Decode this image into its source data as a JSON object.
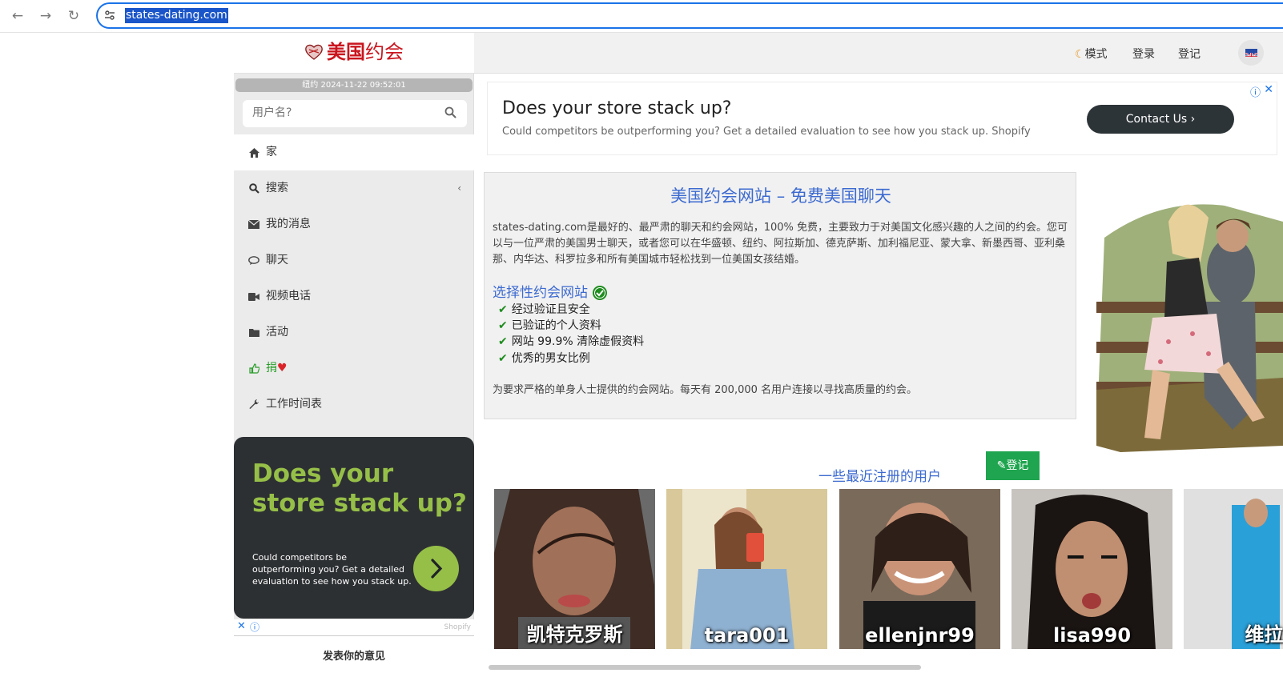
{
  "browser": {
    "url": "states-dating.com"
  },
  "brand": {
    "name_bold": "美国",
    "name_rest": "约会"
  },
  "clock": "纽约 2024-11-22 09:52:01",
  "search": {
    "placeholder": "用户名?"
  },
  "menu": [
    {
      "label": "家",
      "icon": "home-icon"
    },
    {
      "label": "搜索",
      "icon": "search-icon"
    },
    {
      "label": "我的消息",
      "icon": "envelope-icon"
    },
    {
      "label": "聊天",
      "icon": "chat-icon"
    },
    {
      "label": "视频电话",
      "icon": "video-camera-icon"
    },
    {
      "label": "活动",
      "icon": "folder-icon"
    },
    {
      "label": "捐",
      "icon": "thumbs-up-icon"
    },
    {
      "label": "工作时间表",
      "icon": "wrench-icon"
    }
  ],
  "side_ad": {
    "headline": "Does your store stack up?",
    "sub": "Could competitors be outperforming you? Get a detailed evaluation to see how you stack up.",
    "brand": "Shopify"
  },
  "feedback": "发表你的意见",
  "topnav": {
    "mode": "模式",
    "login": "登录",
    "register": "登记"
  },
  "top_ad": {
    "headline": "Does your store stack up?",
    "sub": "Could competitors be outperforming you? Get a detailed evaluation to see how you stack up. Shopify",
    "button": "Contact Us"
  },
  "intro": {
    "title": "美国约会网站 – 免费美国聊天",
    "para": "states-dating.com是最好的、最严肃的聊天和约会网站，100% 免费，主要致力于对美国文化感兴趣的人之间的约会。您可以与一位严肃的美国男士聊天，或者您可以在华盛顿、纽约、阿拉斯加、德克萨斯、加利福尼亚、蒙大拿、新墨西哥、亚利桑那、内华达、科罗拉多和所有美国城市轻松找到一位美国女孩结婚。",
    "selective": "选择性约会网站",
    "checks": [
      "经过验证且安全",
      "已验证的个人资料",
      "网站 99.9% 清除虚假资料",
      "优秀的男女比例"
    ],
    "footer": "为要求严格的单身人士提供的约会网站。每天有 200,000 名用户连接以寻找高质量的约会。",
    "register_button": "登记"
  },
  "recent": {
    "title": "一些最近注册的用户",
    "users": [
      "凯特克罗斯",
      "tara001",
      "ellenjnr99",
      "lisa990",
      "维拉"
    ]
  },
  "colors": {
    "brand_red": "#c9151e",
    "link_blue": "#3c6ad0",
    "register_green": "#1fa54f",
    "ad_green": "#96bf48"
  }
}
